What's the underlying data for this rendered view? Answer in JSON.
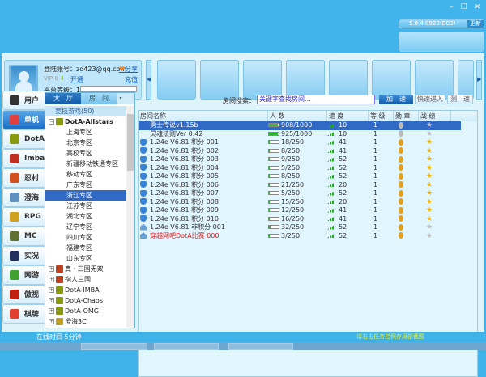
{
  "window": {
    "controls": "– ☐ ✕",
    "version": "5.8.4.0920(BC3)",
    "update_label": "更新"
  },
  "profile": {
    "account_label": "登陆账号：",
    "account": "zd423@qq.com",
    "share_label": "分享",
    "vip_level": "0",
    "open_label": "开通",
    "charge_label": "充值",
    "platform_level_label": "平台等级：",
    "platform_level": "1"
  },
  "sidebar": {
    "items": [
      {
        "label": "用户",
        "color": "#333333"
      },
      {
        "label": "单机",
        "color": "#e04040"
      },
      {
        "label": "DotA",
        "color": "#8a9a10"
      },
      {
        "label": "Imba",
        "color": "#c03020"
      },
      {
        "label": "忍村",
        "color": "#d05020"
      },
      {
        "label": "澄海",
        "color": "#6090c0"
      },
      {
        "label": "RPG",
        "color": "#d0a020"
      },
      {
        "label": "MC",
        "color": "#607030"
      },
      {
        "label": "实况",
        "color": "#203060"
      },
      {
        "label": "网游",
        "color": "#40a030"
      },
      {
        "label": "傲视",
        "color": "#c02010"
      },
      {
        "label": "棋牌",
        "color": "#e04030"
      }
    ],
    "active_index": 1
  },
  "tree": {
    "tabs": [
      "大　厅",
      "房　间"
    ],
    "dropdown": "▾",
    "header": "竞技游戏(50)",
    "root": "DotA-Allstars",
    "children": [
      "上海专区",
      "北京专区",
      "高校专区",
      "新疆移动铁通专区",
      "移动专区",
      "广东专区",
      "浙江专区",
      "江苏专区",
      "湖北专区",
      "辽宁专区",
      "四川专区",
      "福建专区",
      "山东专区"
    ],
    "selected_index": 6,
    "others": [
      {
        "label": "真 · 三国无双",
        "color": "#c04020"
      },
      {
        "label": "指人三国",
        "color": "#c04020"
      },
      {
        "label": "DotA-IMBA",
        "color": "#8a9a10"
      },
      {
        "label": "DotA-Chaos",
        "color": "#8a9a10"
      },
      {
        "label": "DotA-OMG",
        "color": "#8a9a10"
      },
      {
        "label": "澄海3C",
        "color": "#c0a020"
      }
    ]
  },
  "search": {
    "label": "房间搜索：",
    "placeholder": "关键字查找房间...",
    "accelerate": "加　速",
    "quick_enter": "快速进入",
    "speed_test": "测　速"
  },
  "table": {
    "headers": [
      "房间名称",
      "人 数",
      "速 度",
      "等 级",
      "勋 章",
      "战 绩"
    ],
    "rows": [
      {
        "icon": "none",
        "name": "勇士传说v1.15b",
        "players": "908/1000",
        "fill": 0.91,
        "speed": "10",
        "level": "1",
        "medal": "grey",
        "record": "grey"
      },
      {
        "icon": "none",
        "name": "灵魂法则Ver 0.42",
        "players": "925/1000",
        "fill": 0.93,
        "speed": "10",
        "level": "1",
        "medal": "grey",
        "record": "grey"
      },
      {
        "icon": "shield",
        "name": "1.24e V6.81 积分 001",
        "players": "18/250",
        "fill": 0.07,
        "speed": "41",
        "level": "1",
        "medal": "gold",
        "record": "gold"
      },
      {
        "icon": "shield",
        "name": "1.24e V6.81 积分 002",
        "players": "8/250",
        "fill": 0.03,
        "speed": "41",
        "level": "1",
        "medal": "gold",
        "record": "gold"
      },
      {
        "icon": "shield",
        "name": "1.24e V6.81 积分 003",
        "players": "9/250",
        "fill": 0.04,
        "speed": "52",
        "level": "1",
        "medal": "gold",
        "record": "gold"
      },
      {
        "icon": "shield",
        "name": "1.24e V6.81 积分 004",
        "players": "5/250",
        "fill": 0.02,
        "speed": "52",
        "level": "1",
        "medal": "gold",
        "record": "gold"
      },
      {
        "icon": "shield",
        "name": "1.24e V6.81 积分 005",
        "players": "8/250",
        "fill": 0.03,
        "speed": "52",
        "level": "1",
        "medal": "gold",
        "record": "gold"
      },
      {
        "icon": "shield",
        "name": "1.24e V6.81 积分 006",
        "players": "21/250",
        "fill": 0.08,
        "speed": "20",
        "level": "1",
        "medal": "gold",
        "record": "gold"
      },
      {
        "icon": "shield",
        "name": "1.24e V6.81 积分 007",
        "players": "5/250",
        "fill": 0.02,
        "speed": "52",
        "level": "1",
        "medal": "gold",
        "record": "gold"
      },
      {
        "icon": "shield",
        "name": "1.24e V6.81 积分 008",
        "players": "15/250",
        "fill": 0.06,
        "speed": "20",
        "level": "1",
        "medal": "gold",
        "record": "gold"
      },
      {
        "icon": "shield",
        "name": "1.24e V6.81 积分 009",
        "players": "12/250",
        "fill": 0.05,
        "speed": "41",
        "level": "1",
        "medal": "gold",
        "record": "gold"
      },
      {
        "icon": "shield",
        "name": "1.24e V6.81 积分 010",
        "players": "16/250",
        "fill": 0.06,
        "speed": "41",
        "level": "1",
        "medal": "gold",
        "record": "gold"
      },
      {
        "icon": "house",
        "name": "1.24e V6.81 非积分 001",
        "players": "32/250",
        "fill": 0.13,
        "speed": "52",
        "level": "1",
        "medal": "gold",
        "record": "grey"
      },
      {
        "icon": "house",
        "name": "穿越网吧DotA比赛 000",
        "players": "3/250",
        "fill": 0.01,
        "speed": "52",
        "level": "1",
        "medal": "gold",
        "record": "grey",
        "red": true
      }
    ],
    "selected_index": 0
  },
  "status": {
    "online": "在线时间 5分钟",
    "tip": "请右击任务栏保存局部截图"
  }
}
